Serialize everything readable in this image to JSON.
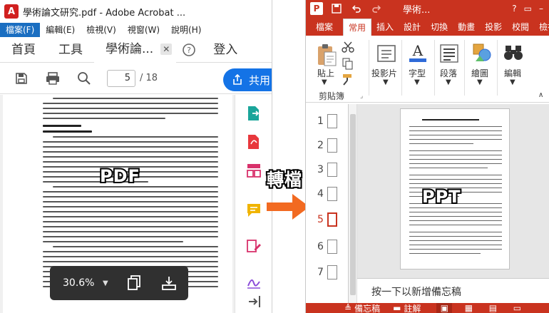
{
  "acrobat": {
    "window_title": "學術論文研究.pdf - Adobe Acrobat ...",
    "menus": [
      {
        "label": "檔案(F)",
        "active": true
      },
      {
        "label": "編輯(E)"
      },
      {
        "label": "檢視(V)"
      },
      {
        "label": "視窗(W)"
      },
      {
        "label": "說明(H)"
      }
    ],
    "tabs": {
      "home": "首頁",
      "tools": "工具",
      "document": "學術論...",
      "signin": "登入"
    },
    "toolbar": {
      "page_current": "5",
      "page_total": "/ 18",
      "share_label": "共用"
    },
    "zoom": {
      "value": "30.6%"
    }
  },
  "overlay": {
    "pdf_label": "PDF",
    "convert_label": "轉檔",
    "ppt_label": "PPT",
    "arrow_color": "#f26a21"
  },
  "powerpoint": {
    "window_title": "學術...",
    "tabs": [
      "檔案",
      "常用",
      "插入",
      "設計",
      "切換",
      "動畫",
      "投影",
      "校閱",
      "檢視"
    ],
    "active_tab_index": 1,
    "ribbon": {
      "paste": "貼上",
      "slides": "投影片",
      "font": "字型",
      "paragraph": "段落",
      "drawing": "繪圖",
      "editing": "編輯",
      "clipboard_group": "剪貼簿"
    },
    "thumbnails": [
      "1",
      "2",
      "3",
      "4",
      "5",
      "6",
      "7"
    ],
    "selected_thumbnail_index": 4,
    "notes_placeholder": "按一下以新增備忘稿",
    "status": {
      "notes": "備忘稿",
      "comments": "註解"
    },
    "colors": {
      "accent": "#c9331f"
    }
  }
}
